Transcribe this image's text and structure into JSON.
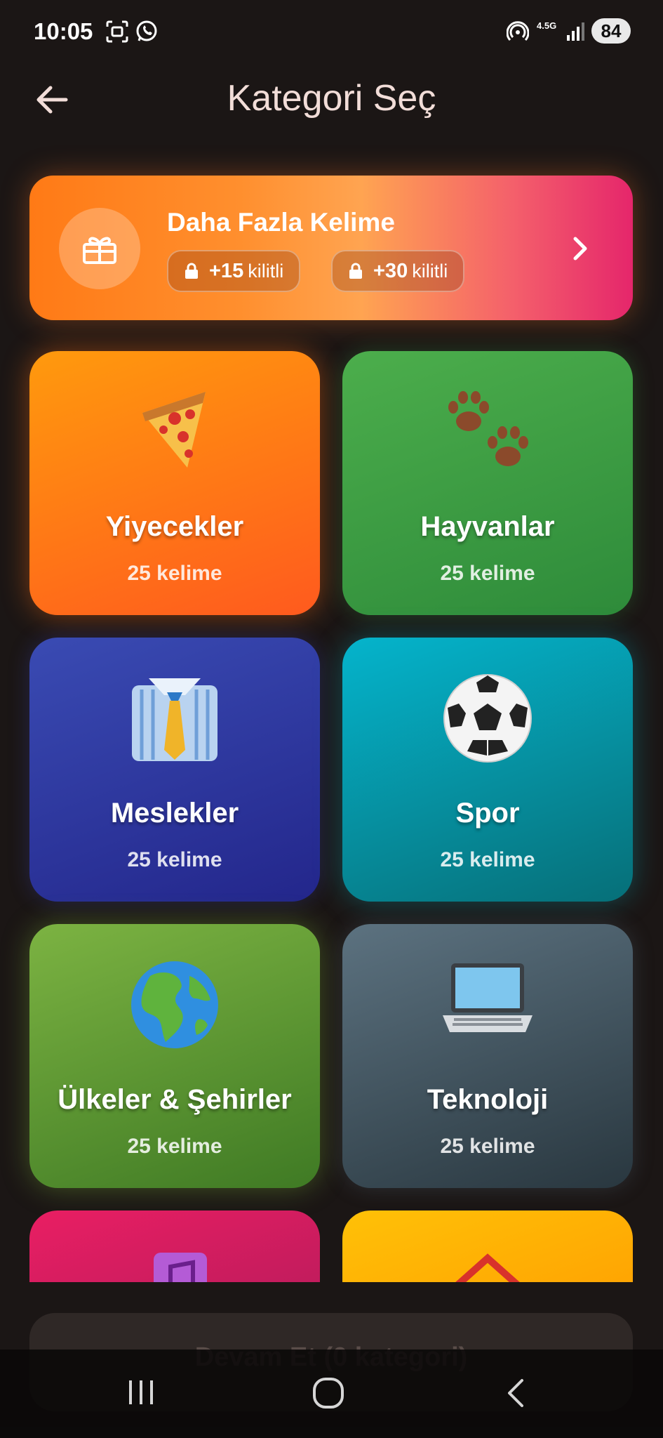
{
  "status_bar": {
    "time": "10:05",
    "network": "4.5G",
    "battery": "84",
    "icons": [
      "screenshot-icon",
      "whatsapp-icon",
      "hotspot-icon",
      "signal-icon"
    ]
  },
  "header": {
    "title": "Kategori Seç",
    "back_icon": "arrow-left-icon"
  },
  "promo": {
    "title": "Daha Fazla Kelime",
    "icon": "gift-icon",
    "chips": [
      {
        "amount": "+15",
        "label": "kilitli"
      },
      {
        "amount": "+30",
        "label": "kilitli"
      }
    ],
    "arrow_icon": "chevron-right-icon"
  },
  "categories": [
    {
      "name": "Yiyecekler",
      "count": "25 kelime",
      "emoji": "🍕",
      "color": "#ff7a12"
    },
    {
      "name": "Hayvanlar",
      "count": "25 kelime",
      "emoji": "🐾",
      "color": "#3f9d45"
    },
    {
      "name": "Meslekler",
      "count": "25 kelime",
      "emoji": "👔",
      "color": "#2f3a9f"
    },
    {
      "name": "Spor",
      "count": "25 kelime",
      "emoji": "⚽",
      "color": "#0596a8"
    },
    {
      "name": "Ülkeler & Şehirler",
      "count": "25 kelime",
      "emoji": "🌍",
      "color": "#5f9a33"
    },
    {
      "name": "Teknoloji",
      "count": "25 kelime",
      "emoji": "💻",
      "color": "#425561"
    },
    {
      "name": "",
      "count": "",
      "emoji": "🎵",
      "color": "#d81b60"
    },
    {
      "name": "",
      "count": "",
      "emoji": "🏠",
      "color": "#ffb300"
    }
  ],
  "continue_button": {
    "label": "Devam Et (0 kategori)"
  },
  "nav_bar": {
    "recents_icon": "recents-icon",
    "home_icon": "home-circle-icon",
    "back_icon": "nav-back-icon"
  }
}
